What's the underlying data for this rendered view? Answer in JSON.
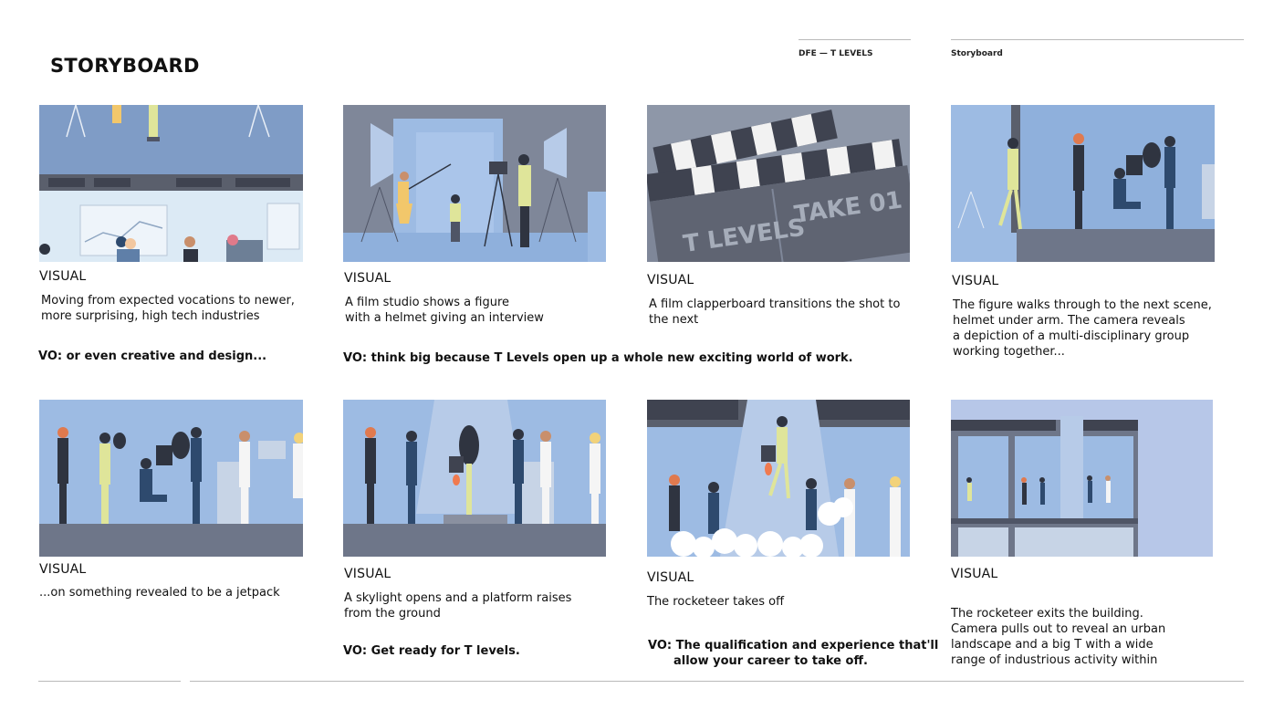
{
  "page_title": "STORYBOARD",
  "header": {
    "project": "DFE — T LEVELS",
    "section": "Storyboard"
  },
  "panels": [
    {
      "label": "VISUAL",
      "description": "Moving from expected vocations to newer,\nmore surprising, high tech industries"
    },
    {
      "label": "VISUAL",
      "description": "A film studio shows a figure\nwith a helmet giving an interview"
    },
    {
      "label": "VISUAL",
      "description": "A film clapperboard transitions the shot to\nthe next",
      "clapper_text_left": "T LEVELS",
      "clapper_text_right": "TAKE 01"
    },
    {
      "label": "VISUAL",
      "description": "The figure walks through to the next scene,\nhelmet under arm. The camera reveals\na depiction of a multi-disciplinary group\nworking together..."
    },
    {
      "label": "VISUAL",
      "description": "...on something revealed to be a jetpack"
    },
    {
      "label": "VISUAL",
      "description": "A skylight opens and a platform raises\nfrom the ground"
    },
    {
      "label": "VISUAL",
      "description": "The rocketeer takes off"
    },
    {
      "label": "VISUAL",
      "description": "The rocketeer exits the building.\nCamera pulls out to reveal an urban\nlandscape and a big T with a wide\nrange of industrious activity within"
    }
  ],
  "voiceovers": {
    "vo1": "VO: or even creative and design...",
    "vo2": "VO: think big because T Levels open up a whole new exciting world of work.",
    "vo3": "VO: Get ready for T levels.",
    "vo4_line1": "VO: The qualification and experience that'll",
    "vo4_line2": "allow your career to take off."
  },
  "colors": {
    "sky_blue": "#9dbbe3",
    "slate": "#747d90",
    "dark_slate": "#4f5566",
    "figure_yellow": "#dfe59a",
    "navy": "#2e4a6e",
    "rule_grey": "#b9b9b9"
  }
}
